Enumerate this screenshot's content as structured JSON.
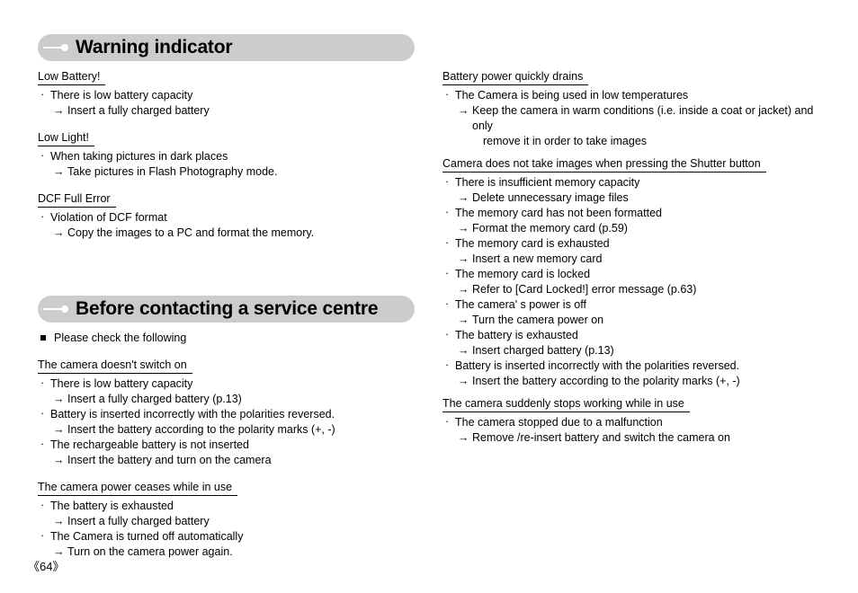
{
  "page": {
    "number_label": "《64》"
  },
  "sections": [
    {
      "banner": {
        "title": "Warning indicator",
        "decoration_icon": "line-dot-icon"
      },
      "groups": [
        {
          "heading": "Low Battery!",
          "items": [
            {
              "cause": "There is low battery capacity",
              "remedy": "Insert a fully charged battery"
            }
          ]
        },
        {
          "heading": "Low Light!",
          "items": [
            {
              "cause": "When taking pictures in dark places",
              "remedy": "Take pictures in Flash Photography mode."
            }
          ]
        },
        {
          "heading": "DCF Full Error",
          "items": [
            {
              "cause": "Violation of DCF format",
              "remedy": "Copy the images to a PC and format the memory."
            }
          ]
        }
      ]
    },
    {
      "banner": {
        "title": "Before contacting a service centre",
        "decoration_icon": "line-dot-icon"
      },
      "intro": "Please check the following",
      "groups": [
        {
          "heading": "The camera doesn't switch on",
          "items": [
            {
              "cause": "There is low battery capacity",
              "remedy": "Insert a fully charged battery (p.13)"
            },
            {
              "cause": "Battery is inserted incorrectly with the polarities reversed.",
              "remedy": "Insert the battery according to the polarity marks (+, -)"
            },
            {
              "cause": "The rechargeable battery is not inserted",
              "remedy": "Insert the battery and turn on the camera"
            }
          ]
        },
        {
          "heading": "The camera power ceases while in use",
          "items": [
            {
              "cause": "The battery is exhausted",
              "remedy": "Insert a fully charged battery"
            },
            {
              "cause": "The Camera is turned off automatically",
              "remedy": "Turn on the camera power again."
            }
          ]
        }
      ]
    }
  ],
  "right_column": {
    "groups": [
      {
        "heading": "Battery power quickly drains",
        "items": [
          {
            "cause": "The Camera is being used in low temperatures",
            "remedy": "Keep the camera in warm conditions (i.e. inside a coat or jacket) and only",
            "remedy_cont": "remove it in order to take images"
          }
        ]
      },
      {
        "heading": "Camera does not take images when pressing the Shutter button",
        "items": [
          {
            "cause": "There is insufficient memory capacity",
            "remedy": "Delete unnecessary image files"
          },
          {
            "cause": "The memory card has not been formatted",
            "remedy": "Format the memory card (p.59)"
          },
          {
            "cause": "The memory card is exhausted",
            "remedy": "Insert a new memory card"
          },
          {
            "cause": "The memory card is locked",
            "remedy": "Refer to [Card Locked!] error message (p.63)"
          },
          {
            "cause": "The camera' s power is off",
            "remedy": "Turn the camera power on"
          },
          {
            "cause": "The battery is exhausted",
            "remedy": "Insert charged battery (p.13)"
          },
          {
            "cause": "Battery is inserted incorrectly with the polarities reversed.",
            "remedy": "Insert the battery according to the polarity marks (+, -)"
          }
        ]
      },
      {
        "heading": "The camera suddenly stops working while in use",
        "items": [
          {
            "cause": "The camera stopped due to a malfunction",
            "remedy": "Remove /re-insert battery and switch the camera on"
          }
        ]
      }
    ]
  },
  "glyphs": {
    "cause_marker": "·",
    "remedy_arrow": "→"
  }
}
